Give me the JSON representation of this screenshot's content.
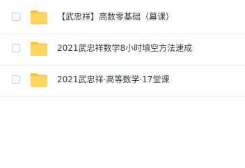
{
  "file_list": {
    "items": [
      {
        "name": "【武忠祥】高数零基础（幕课）",
        "type": "folder",
        "icon": "folder-icon",
        "checked": false
      },
      {
        "name": "2021武忠祥数学8小时填空方法速成",
        "type": "folder",
        "icon": "folder-icon",
        "checked": false
      },
      {
        "name": "2021武忠祥·高等数学·17堂课",
        "type": "folder",
        "icon": "folder-icon",
        "checked": false
      }
    ]
  },
  "colors": {
    "folder_body": "#ffd65c",
    "folder_tab": "#f5c242",
    "text": "#333740",
    "divider": "#f1f1f3",
    "checkbox_border": "#cfcfd3"
  }
}
